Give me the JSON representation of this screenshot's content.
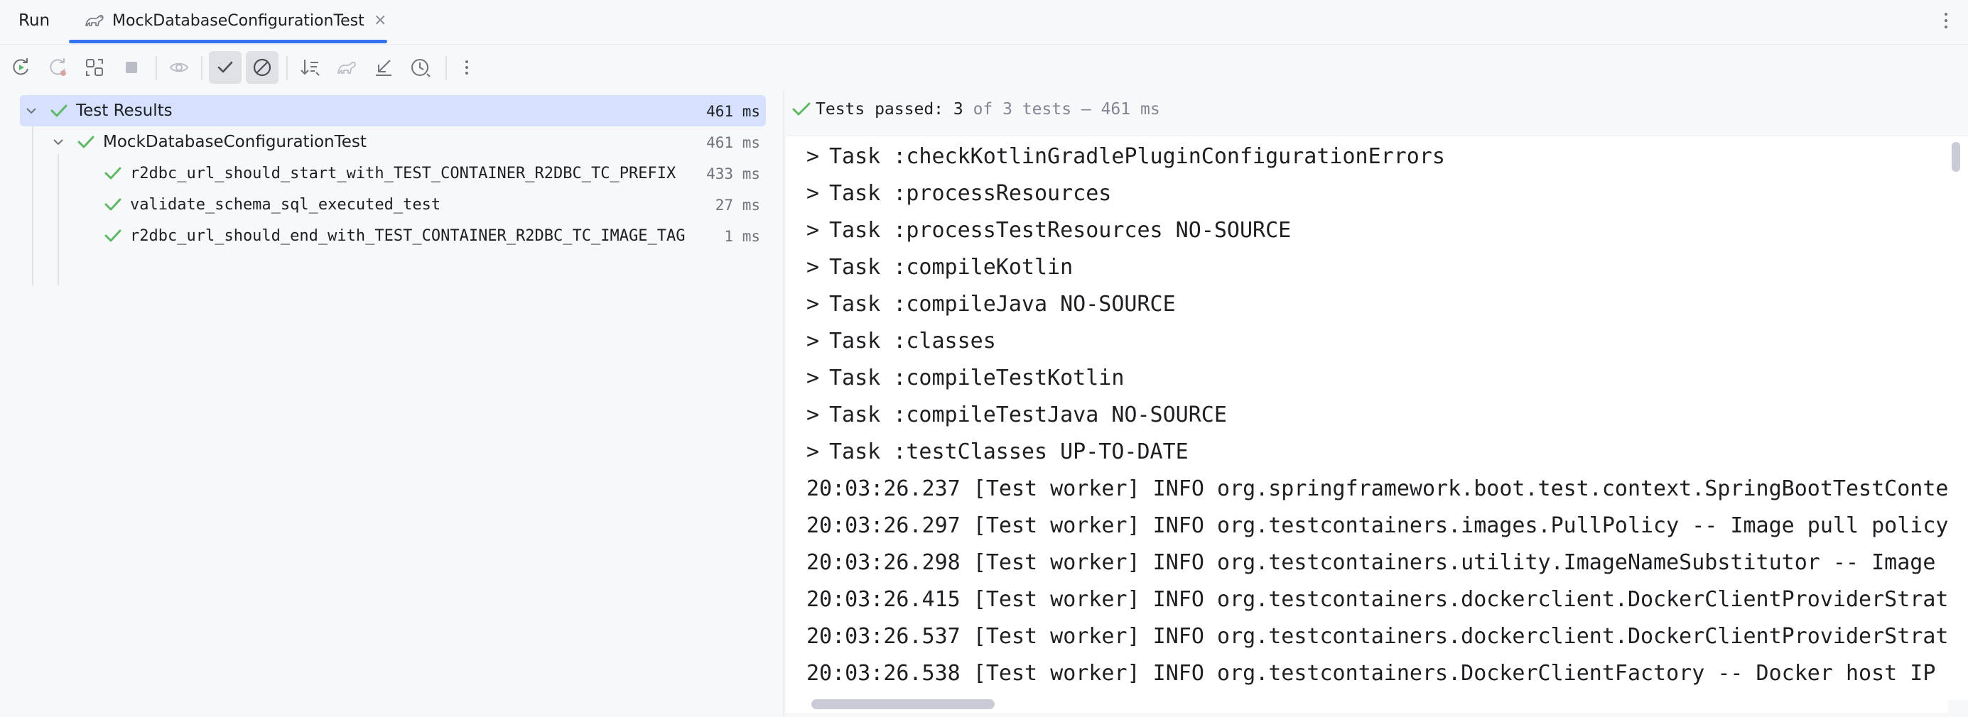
{
  "tabs": {
    "run_label": "Run",
    "active_tab_label": "MockDatabaseConfigurationTest",
    "close_symbol": "×"
  },
  "toolbar": {
    "icons": [
      "rerun-icon",
      "rerun-failed-icon",
      "toggle-auto-test-icon",
      "stop-icon",
      "show-ignored-icon",
      "show-passed-icon",
      "show-ignored-toggle-icon",
      "sort-icon",
      "gradle-icon",
      "import-tests-icon",
      "history-icon",
      "more-icon"
    ]
  },
  "tree": {
    "root": {
      "label": "Test Results",
      "time": "461 ms",
      "status": "passed"
    },
    "suite": {
      "label": "MockDatabaseConfigurationTest",
      "time": "461 ms",
      "status": "passed"
    },
    "tests": [
      {
        "label": "r2dbc_url_should_start_with_TEST_CONTAINER_R2DBC_TC_PREFIX",
        "time": "433 ms",
        "status": "passed"
      },
      {
        "label": "validate_schema_sql_executed_test",
        "time": "27 ms",
        "status": "passed"
      },
      {
        "label": "r2dbc_url_should_end_with_TEST_CONTAINER_R2DBC_TC_IMAGE_TAG",
        "time": "1 ms",
        "status": "passed"
      }
    ]
  },
  "status": {
    "passed_prefix": "Tests passed: 3",
    "passed_suffix": " of 3 tests – 461 ms"
  },
  "console": {
    "tasks": [
      "Task :checkKotlinGradlePluginConfigurationErrors",
      "Task :processResources",
      "Task :processTestResources NO-SOURCE",
      "Task :compileKotlin",
      "Task :compileJava NO-SOURCE",
      "Task :classes",
      "Task :compileTestKotlin",
      "Task :compileTestJava NO-SOURCE",
      "Task :testClasses UP-TO-DATE"
    ],
    "logs": [
      "20:03:26.237 [Test worker] INFO org.springframework.boot.test.context.SpringBootTestContextBoot",
      "20:03:26.297 [Test worker] INFO org.testcontainers.images.PullPolicy -- Image pull policy will",
      "20:03:26.298 [Test worker] INFO org.testcontainers.utility.ImageNameSubstitutor -- Image name s",
      "20:03:26.415 [Test worker] INFO org.testcontainers.dockerclient.DockerClientProviderStrategy --",
      "20:03:26.537 [Test worker] INFO org.testcontainers.dockerclient.DockerClientProviderStrategy --",
      "20:03:26.538 [Test worker] INFO org.testcontainers.DockerClientFactory -- Docker host IP addres"
    ]
  },
  "colors": {
    "accent": "#3574f0",
    "pass_green": "#5fb865",
    "selected_row": "#d5e1ff"
  }
}
